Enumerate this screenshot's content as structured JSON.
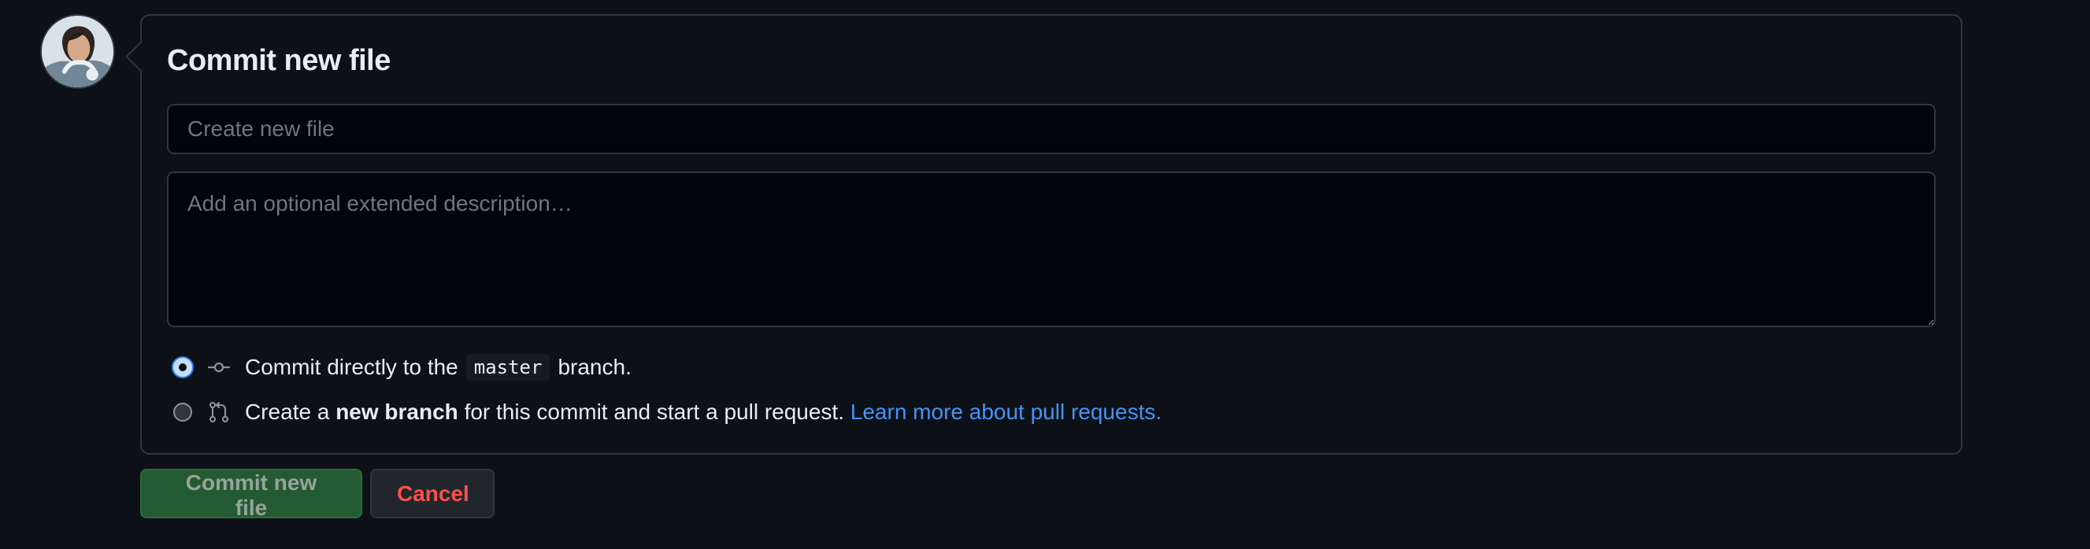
{
  "avatar": {
    "alt": "User avatar"
  },
  "commit": {
    "title": "Commit new file",
    "summary_placeholder": "Create new file",
    "description_placeholder": "Add an optional extended description…",
    "direct_option": {
      "prefix": "Commit directly to the",
      "branch": "master",
      "suffix": "branch.",
      "icon": "git-commit-icon"
    },
    "new_branch_option": {
      "prefix": "Create a",
      "bold": "new branch",
      "middle": "for this commit and start a pull request.",
      "link": "Learn more about pull requests.",
      "icon": "git-pull-request-icon"
    }
  },
  "actions": {
    "submit_label": "Commit new file",
    "cancel_label": "Cancel"
  },
  "colors": {
    "background": "#0d1117",
    "border": "#30363d",
    "accent_link": "#4493f8",
    "primary_button": "#245a32",
    "danger_text": "#f85149"
  }
}
